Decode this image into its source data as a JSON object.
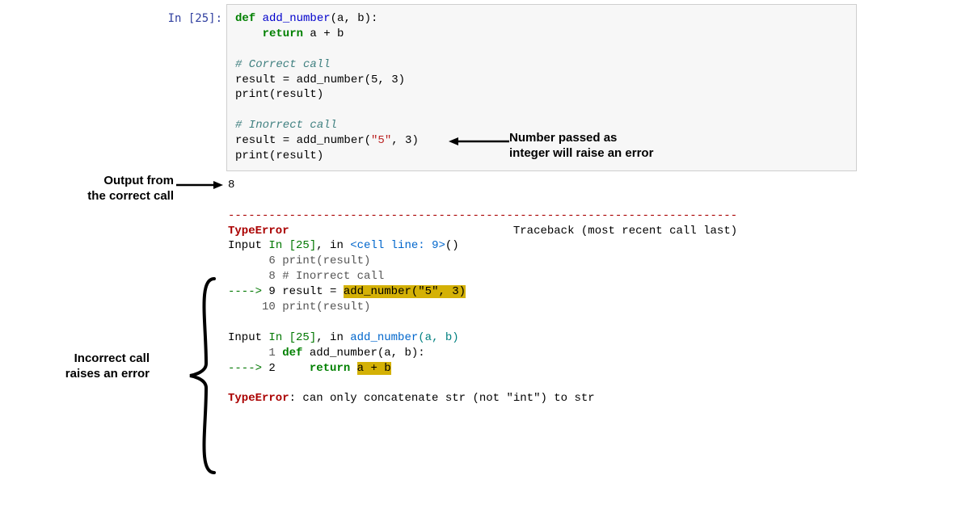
{
  "prompt": "In [25]:",
  "code": {
    "line1_def": "def",
    "line1_fn": " add_number",
    "line1_rest": "(a, b):",
    "line2_ret": "    return",
    "line2_rest": " a + b",
    "blank1": "",
    "line3_comment": "# Correct call",
    "line4": "result = add_number(5, 3)",
    "line5": "print(result)",
    "blank2": "",
    "line6_comment": "# Inorrect call",
    "line7_pre": "result = add_number(",
    "line7_str": "\"5\"",
    "line7_post": ", 3)",
    "line8": "print(result)"
  },
  "output_ok": "8",
  "dashes": "---------------------------------------------------------------------------",
  "traceback": {
    "err_name": "TypeError",
    "trace_label": "Traceback (most recent call last)",
    "t1_pre": "Input ",
    "t1_in": "In [25]",
    "t1_mid": ", in ",
    "t1_loc": "<cell line: 9>",
    "t1_post": "()",
    "t2": "      6 print(result)",
    "t3": "      8 # Inorrect call",
    "t4_arrow": "----> ",
    "t4_num": "9 ",
    "t4_pre": "result = ",
    "t4_hl": "add_number(\"5\", 3)",
    "t5": "     10 print(result)",
    "blank": "",
    "t6_pre": "Input ",
    "t6_in": "In [25]",
    "t6_mid": ", in ",
    "t6_fn": "add_number",
    "t6_args": "(a, b)",
    "t7_num": "      1 ",
    "t7_def": "def",
    "t7_rest": " add_number(a, b):",
    "t8_arrow": "----> ",
    "t8_num": "2     ",
    "t8_ret": "return",
    "t8_sp": " ",
    "t8_hl": "a + b",
    "blank2": "",
    "final_err": "TypeError",
    "final_msg": ": can only concatenate str (not \"int\") to str"
  },
  "annotations": {
    "right1": "Number passed as",
    "right2": "integer will raise an error",
    "left1a": "Output from",
    "left1b": "the correct call",
    "left2a": "Incorrect call",
    "left2b": "raises an error"
  }
}
